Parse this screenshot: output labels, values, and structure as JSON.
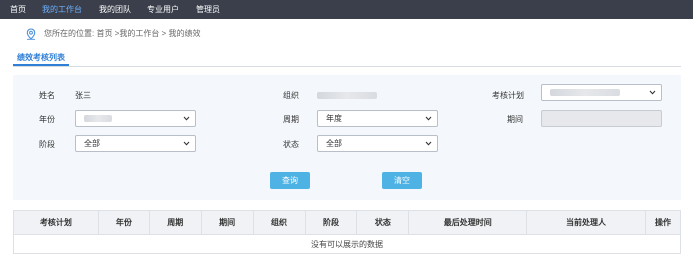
{
  "topnav": {
    "items": [
      {
        "label": "首页",
        "active": false
      },
      {
        "label": "我的工作台",
        "active": true
      },
      {
        "label": "我的团队",
        "active": false
      },
      {
        "label": "专业用户",
        "active": false
      },
      {
        "label": "管理员",
        "active": false
      }
    ],
    "active_color": "#6fb0ff",
    "background": "#3a3f4b"
  },
  "breadcrumb": {
    "icon": "location-pin-icon",
    "text": "您所在的位置: 首页 >我的工作台 > 我的绩效"
  },
  "tab": {
    "label": "绩效考核列表"
  },
  "filters": {
    "name_label": "姓名",
    "name_value": "张三",
    "org_label": "组织",
    "plan_label": "考核计划",
    "year_label": "年份",
    "period_type_label": "周期",
    "period_type_value": "年度",
    "period_label": "期间",
    "stage_label": "阶段",
    "stage_value": "全部",
    "status_label": "状态",
    "status_value": "全部"
  },
  "buttons": {
    "query": "查询",
    "clear": "清空"
  },
  "table": {
    "columns": [
      "考核计划",
      "年份",
      "周期",
      "期间",
      "组织",
      "阶段",
      "状态",
      "最后处理时间",
      "当前处理人",
      "操作"
    ],
    "empty_message": "没有可以展示的数据"
  },
  "colors": {
    "accent": "#2f7fd6",
    "button": "#4fb2e4",
    "panel": "#f4f7fb"
  }
}
